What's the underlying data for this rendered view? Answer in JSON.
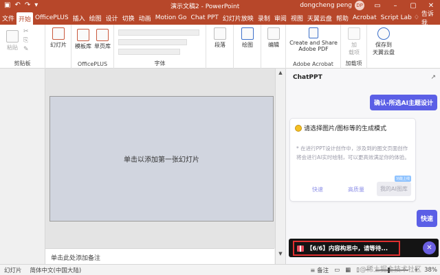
{
  "titlebar": {
    "title": "演示文稿2 - PowerPoint",
    "user_name": "dongcheng peng",
    "avatar_initials": "DP",
    "save_icon": "save-icon",
    "undo_icon": "undo-icon",
    "redo_icon": "redo-icon"
  },
  "tabs": [
    {
      "label": "文件"
    },
    {
      "label": "开始"
    },
    {
      "label": "OfficePLUS"
    },
    {
      "label": "插入"
    },
    {
      "label": "绘图"
    },
    {
      "label": "设计"
    },
    {
      "label": "切换"
    },
    {
      "label": "动画"
    },
    {
      "label": "Motion Go"
    },
    {
      "label": "Chat PPT"
    },
    {
      "label": "幻灯片放映"
    },
    {
      "label": "录制"
    },
    {
      "label": "审阅"
    },
    {
      "label": "视图"
    },
    {
      "label": "天翼云盘"
    },
    {
      "label": "帮助"
    },
    {
      "label": "Acrobat"
    },
    {
      "label": "Script Lab"
    }
  ],
  "tell_me": "告诉我",
  "ribbon": {
    "clipboard": {
      "paste": "粘贴",
      "label": "剪贴板"
    },
    "slides": {
      "new_slide": "幻灯片"
    },
    "officeplus": {
      "template_lib": "模板库",
      "page_lib": "单页库",
      "label": "OfficePLUS"
    },
    "font": {
      "label": "字体"
    },
    "paragraph": {
      "label": "段落"
    },
    "drawing": {
      "label": "绘图"
    },
    "editing": {
      "label": "编辑"
    },
    "acrobat": {
      "create_share": "Create and Share",
      "adobe_pdf": "Adobe PDF",
      "label": "Adobe Acrobat"
    },
    "addins": {
      "load_1": "加",
      "load_2": "载项",
      "label": "加载项"
    },
    "tianyi": {
      "save_to": "保存到",
      "cloud": "天翼云盘"
    }
  },
  "slide": {
    "placeholder": "单击以添加第一张幻灯片"
  },
  "notes": {
    "placeholder": "单击此处添加备注"
  },
  "chat": {
    "title": "ChatPPT",
    "user_message": "确认-所选AI主题设计",
    "card_title": "请选择图片/图标等的生成模式",
    "card_desc": "* 在进行PPT设计创作中，涉及到的图文页面创作将会进行AI实时绘制，可以更高效满足你的体验。",
    "options": [
      "快速",
      "高质量",
      "我的AI图库"
    ],
    "option_badge": "功能上线",
    "fast_reply": "快速",
    "status_text": "【6/6】内容构思中，请等待..."
  },
  "statusbar": {
    "slide_label": "幻灯片",
    "language": "简体中文(中国大陆)",
    "notes_label": "备注",
    "zoom": "38%"
  },
  "watermark": "@稀土掘金技术社区",
  "colors": {
    "accent": "#b7472a",
    "chat_accent": "#5b5fe6",
    "status_border": "#e02f2f"
  }
}
